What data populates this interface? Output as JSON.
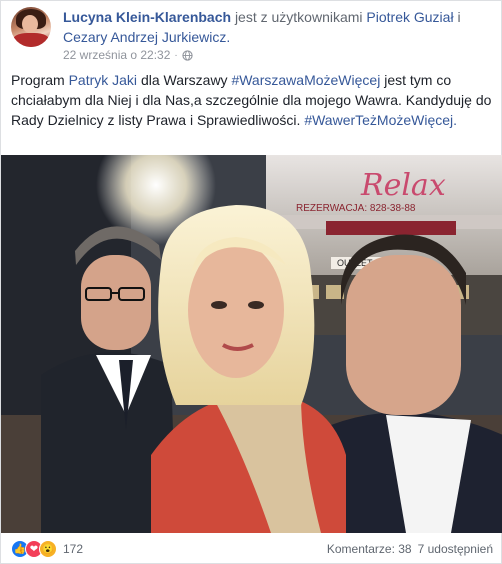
{
  "header": {
    "author": "Lucyna Klein-Klarenbach",
    "with_text": "jest z użytkownikami",
    "tag1": "Piotrek Guział",
    "and_text": "i",
    "tag2": "Cezary Andrzej Jurkiewicz.",
    "timestamp": "22 września o 22:32",
    "privacy_icon": "globe-icon",
    "more_label": "···"
  },
  "post": {
    "t1": "Program",
    "l1": "Patryk Jaki",
    "t2": "dla Warszawy",
    "l2": "#WarszawaMożeWięcej",
    "t3": "jest tym co chciałabym dla Niej i dla Nas,a szczególnie dla mojego Wawra. Kandyduję do Rady Dzielnicy z listy Prawa i Sprawiedliwości.",
    "l3": "#WawerTeżMożeWięcej."
  },
  "photo": {
    "sign_relax": "Relax",
    "sign_rez": "REZERWACJA: 828-38-88",
    "sign_outlet": "OUTLET"
  },
  "footer": {
    "reaction_icons": [
      "like-icon",
      "love-icon",
      "wow-icon"
    ],
    "reaction_count": "172",
    "comments": "Komentarze: 38",
    "shares": "7 udostępnień"
  },
  "colors": {
    "link": "#365899",
    "meta": "#90949c",
    "like": "#1877f2",
    "love": "#f33e58",
    "wow": "#f7b125"
  }
}
